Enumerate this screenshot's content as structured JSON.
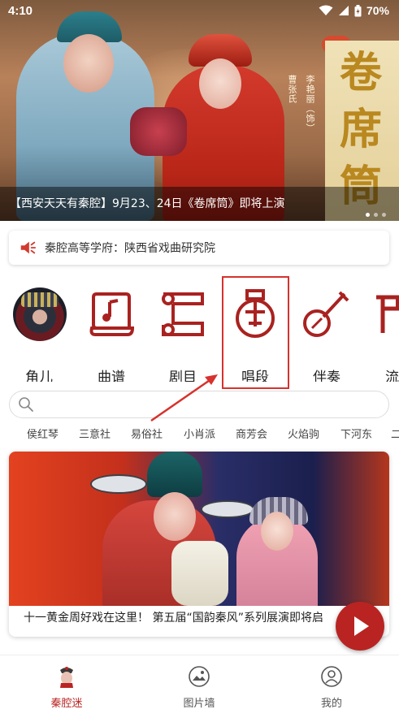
{
  "status_bar": {
    "time": "4:10",
    "battery": "70%"
  },
  "banner": {
    "caption": "【西安天天有秦腔】9月23、24日《卷席筒》即将上演",
    "poster_chars": [
      "卷",
      "席",
      "筒"
    ],
    "credit_a": "曹张氏",
    "credit_b": "李艳丽（饰）",
    "page_count": 3,
    "active_page": 1
  },
  "notice": {
    "text": "秦腔高等学府：陕西省戏曲研究院",
    "icon": "speaker-icon"
  },
  "categories": [
    {
      "label": "角儿",
      "icon": "avatar-image"
    },
    {
      "label": "曲谱",
      "icon": "music-score-icon"
    },
    {
      "label": "剧目",
      "icon": "scroll-icon"
    },
    {
      "label": "唱段",
      "icon": "pipa-icon"
    },
    {
      "label": "伴奏",
      "icon": "banjo-icon"
    },
    {
      "label": "流派",
      "icon": "gate-icon"
    }
  ],
  "search": {
    "placeholder": ""
  },
  "tags": [
    "侯红琴",
    "三意社",
    "易俗社",
    "小肖派",
    "商芳会",
    "火焰驹",
    "下河东",
    "二"
  ],
  "feature_card": {
    "title": "十一黄金周好戏在这里！ 第五届“国韵秦风”系列展演即将启"
  },
  "bottom_nav": [
    {
      "label": "秦腔迷",
      "icon": "opera-mask-icon",
      "active": true
    },
    {
      "label": "图片墙",
      "icon": "picture-icon",
      "active": false
    },
    {
      "label": "我的",
      "icon": "profile-icon",
      "active": false
    }
  ],
  "colors": {
    "brand_red": "#b92422",
    "highlight_red": "#d7322e"
  }
}
